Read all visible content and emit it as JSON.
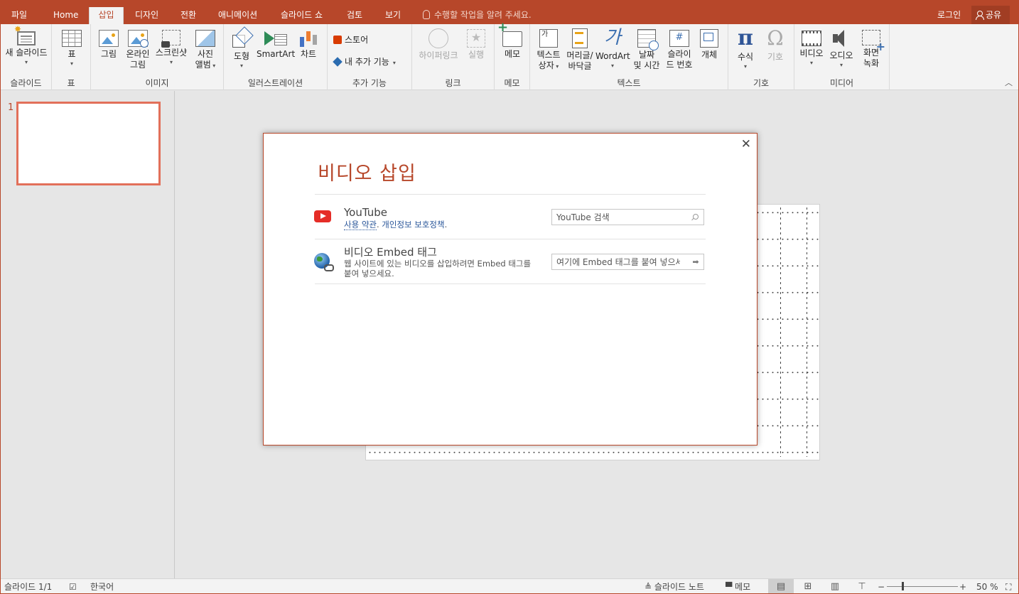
{
  "tabs": [
    "파일",
    "Home",
    "삽입",
    "디자인",
    "전환",
    "애니메이션",
    "슬라이드 쇼",
    "검토",
    "보기"
  ],
  "active_tab": "삽입",
  "tell_me": "수행할 작업을 알려 주세요.",
  "login": "로그인",
  "share": "공유",
  "ribbon": {
    "groups": {
      "slides": "슬라이드",
      "table": "표",
      "images": "이미지",
      "illustrations": "일러스트레이션",
      "addins": "추가 기능",
      "links": "링크",
      "comments": "메모",
      "text": "텍스트",
      "symbols": "기호",
      "media": "미디어"
    },
    "buttons": {
      "new_slide": "새 슬라이드",
      "table": "표",
      "pictures": "그림",
      "online_pictures_1": "온라인",
      "online_pictures_2": "그림",
      "screenshot": "스크린샷",
      "album_1": "사진",
      "album_2": "앨범",
      "shapes": "도형",
      "smartart": "SmartArt",
      "chart": "차트",
      "store": "스토어",
      "my_addins": "내 추가 기능",
      "hyperlink": "하이퍼링크",
      "action": "실행",
      "comment": "메모",
      "textbox_1": "텍스트",
      "textbox_2": "상자",
      "header_1": "머리글/",
      "header_2": "바닥글",
      "wordart": "WordArt",
      "datetime_1": "날짜",
      "datetime_2": "및 시간",
      "slidenum_1": "슬라이",
      "slidenum_2": "드 번호",
      "object": "개체",
      "equation": "수식",
      "symbol": "기호",
      "video": "비디오",
      "audio": "오디오",
      "screenrec_1": "화면",
      "screenrec_2": "녹화"
    }
  },
  "thumbnail": {
    "number": "1"
  },
  "dialog": {
    "title": "비디오 삽입",
    "youtube": {
      "name": "YouTube",
      "terms": "사용 약관",
      "sep": ". ",
      "privacy": "개인정보 보호정책",
      "end": ".",
      "search_placeholder": "YouTube 검색"
    },
    "embed": {
      "name": "비디오 Embed 태그",
      "desc": "웹 사이트에 있는 비디오를 삽입하려면 Embed 태그를 붙여 넣으세요.",
      "placeholder": "여기에 Embed 태그를 붙여 넣으세요"
    }
  },
  "status": {
    "slide_count": "슬라이드 1/1",
    "language": "한국어",
    "notes": "슬라이드 노트",
    "comments": "메모",
    "zoom": "50 %"
  },
  "colors": {
    "accent": "#b7472a",
    "thumb_border": "#e2705a",
    "youtube_red": "#e52d27"
  }
}
